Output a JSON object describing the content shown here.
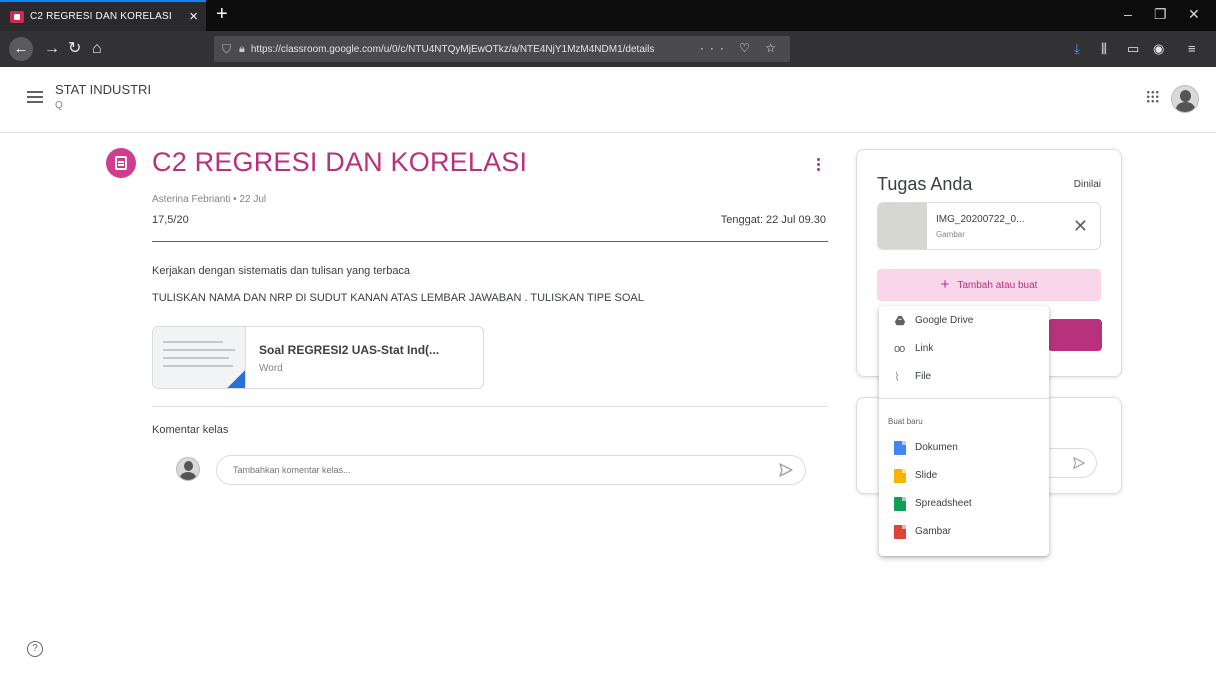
{
  "browser": {
    "tab_title": "C2 REGRESI DAN KORELASI",
    "tab_close": "×",
    "new_tab": "+",
    "url": "https://classroom.google.com/u/0/c/NTU4NTQyMjEwOTkz/a/NTE4NjY1MzM4NDM1/details",
    "url_actions": "··· ♡ ☆",
    "window_controls": [
      "‒",
      "❐",
      "✕"
    ],
    "toolbar_icons": [
      "download-icon",
      "library-icon",
      "sidebar-icon",
      "account-icon",
      "menu-icon"
    ]
  },
  "header": {
    "course_name": "STAT INDUSTRI",
    "course_section": "Q"
  },
  "assignment": {
    "title": "C2 REGRESI DAN KORELASI",
    "author_date": "Asterina Febrianti • 22 Jul",
    "points": "17,5/20",
    "due": "Tenggat: 22 Jul 09.30",
    "description_1": "Kerjakan dengan sistematis dan  tulisan yang terbaca",
    "description_2": "TULISKAN NAMA DAN NRP DI SUDUT KANAN ATAS LEMBAR JAWABAN . TULISKAN TIPE SOAL",
    "attachment": {
      "name": "Soal REGRESI2 UAS-Stat Ind(...",
      "type": "Word"
    }
  },
  "comments": {
    "label": "Komentar kelas",
    "placeholder": "Tambahkan komentar kelas..."
  },
  "work_panel": {
    "title": "Tugas Anda",
    "status": "Dinilai",
    "file": {
      "name": "IMG_20200722_0...",
      "type": "Gambar"
    },
    "add_button": "Tambah atau buat",
    "add_icon": "+"
  },
  "add_menu": {
    "items": [
      {
        "label": "Google Drive",
        "icon": "google-drive-icon"
      },
      {
        "label": "Link",
        "icon": "link-icon"
      },
      {
        "label": "File",
        "icon": "paperclip-icon"
      }
    ],
    "section_label": "Buat baru",
    "create_items": [
      {
        "label": "Dokumen",
        "icon": "docs-icon",
        "color": "#4285f4"
      },
      {
        "label": "Slide",
        "icon": "slides-icon",
        "color": "#f4b400"
      },
      {
        "label": "Spreadsheet",
        "icon": "sheets-icon",
        "color": "#0f9d58"
      },
      {
        "label": "Gambar",
        "icon": "drawings-icon",
        "color": "#db4437"
      }
    ]
  },
  "colors": {
    "accent": "#b8317d",
    "accent_light": "#f8d7ea"
  }
}
